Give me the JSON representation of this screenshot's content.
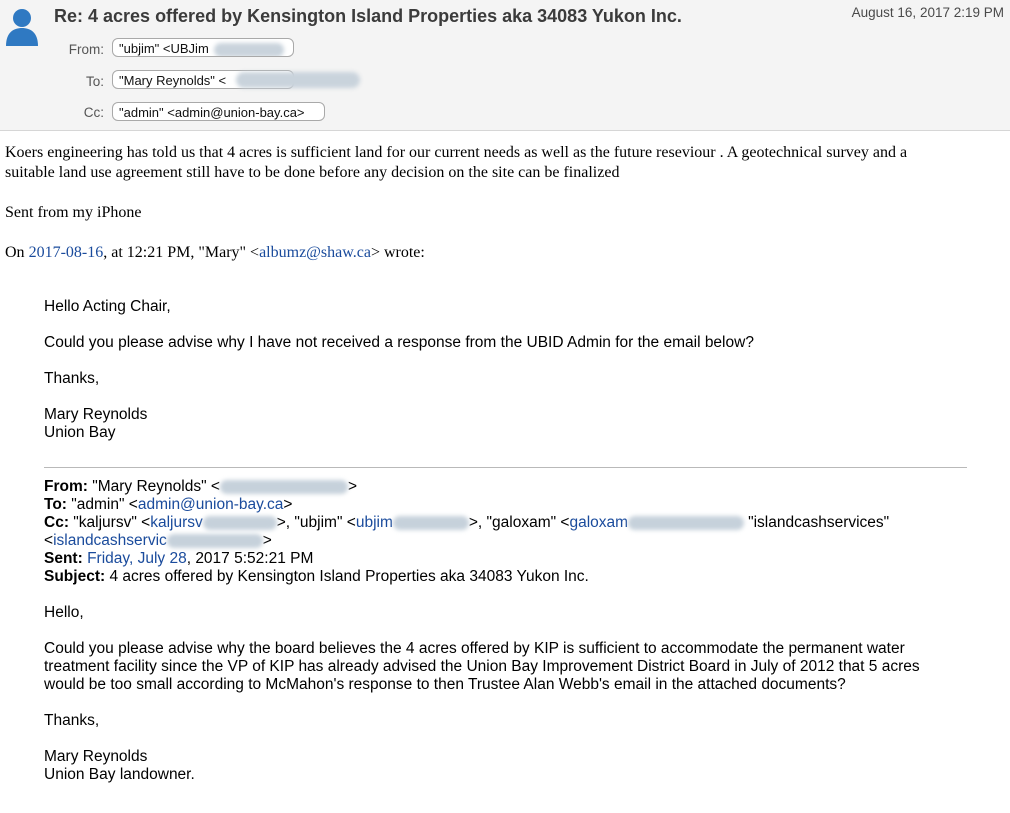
{
  "header": {
    "subject": "Re: 4 acres offered by Kensington Island Properties aka 34083 Yukon Inc.",
    "date": "August 16, 2017 2:19 PM",
    "from_label": "From:",
    "from_value": "\"ubjim\" <UBJim",
    "to_label": "To:",
    "to_value": "\"Mary Reynolds\" <",
    "cc_label": "Cc:",
    "cc_value": "\"admin\" <admin@union-bay.ca>"
  },
  "reply": {
    "body_line1": "Koers engineering has told us that 4 acres is sufficient land for our current needs as well as the future reseviour . A geotechnical survey and a",
    "body_line2": "suitable land use agreement still have to be done before any decision on the site can be finalized",
    "signature": "Sent from my iPhone",
    "attribution_prefix": "On ",
    "attribution_date": "2017-08-16",
    "attribution_middle": ", at 12:21 PM, \"Mary\" <",
    "attribution_email": "albumz@shaw.ca",
    "attribution_suffix": "> wrote:"
  },
  "quoted": {
    "greeting": "Hello Acting Chair,",
    "question": "Could you please advise why I have not received a response from the UBID Admin for the email below?",
    "thanks": "Thanks,",
    "sig_name": "Mary Reynolds",
    "sig_place": "Union Bay"
  },
  "forwarded": {
    "from_label": "From:",
    "from_value": " \"Mary Reynolds\" <",
    "from_end": ">",
    "to_label": "To:",
    "to_value": " \"admin\" <",
    "to_email": "admin@union-bay.ca",
    "to_end": ">",
    "cc_label": "Cc:",
    "cc_part1": " \"kaljursv\" <",
    "cc_email1": "kaljursv",
    "cc_part2": ">, \"ubjim\" <",
    "cc_email2": "ubjim",
    "cc_part3": ">, \"galoxam\" <",
    "cc_email3": "galoxam",
    "cc_part4": "\"islandcashservices\"",
    "cc_line2_start": "<",
    "cc_email4": "islandcashservic",
    "cc_line2_end": ">",
    "sent_label": "Sent:",
    "sent_date_link": "Friday, July 28",
    "sent_rest": ", 2017 5:52:21 PM",
    "subject_label": "Subject:",
    "subject_value": " 4 acres offered by Kensington Island Properties aka 34083 Yukon Inc.",
    "greeting": "Hello,",
    "body_line1": "Could you please advise why the board believes the 4 acres offered by KIP is sufficient to accommodate the permanent water",
    "body_line2": "treatment facility since the VP of KIP has already advised the Union Bay Improvement District Board in July of 2012 that 5 acres",
    "body_line3": "would be too small according to McMahon's response to then Trustee Alan Webb's email in the attached documents?",
    "thanks": "Thanks,",
    "sig_name": "Mary Reynolds",
    "sig_role": "Union Bay landowner."
  }
}
